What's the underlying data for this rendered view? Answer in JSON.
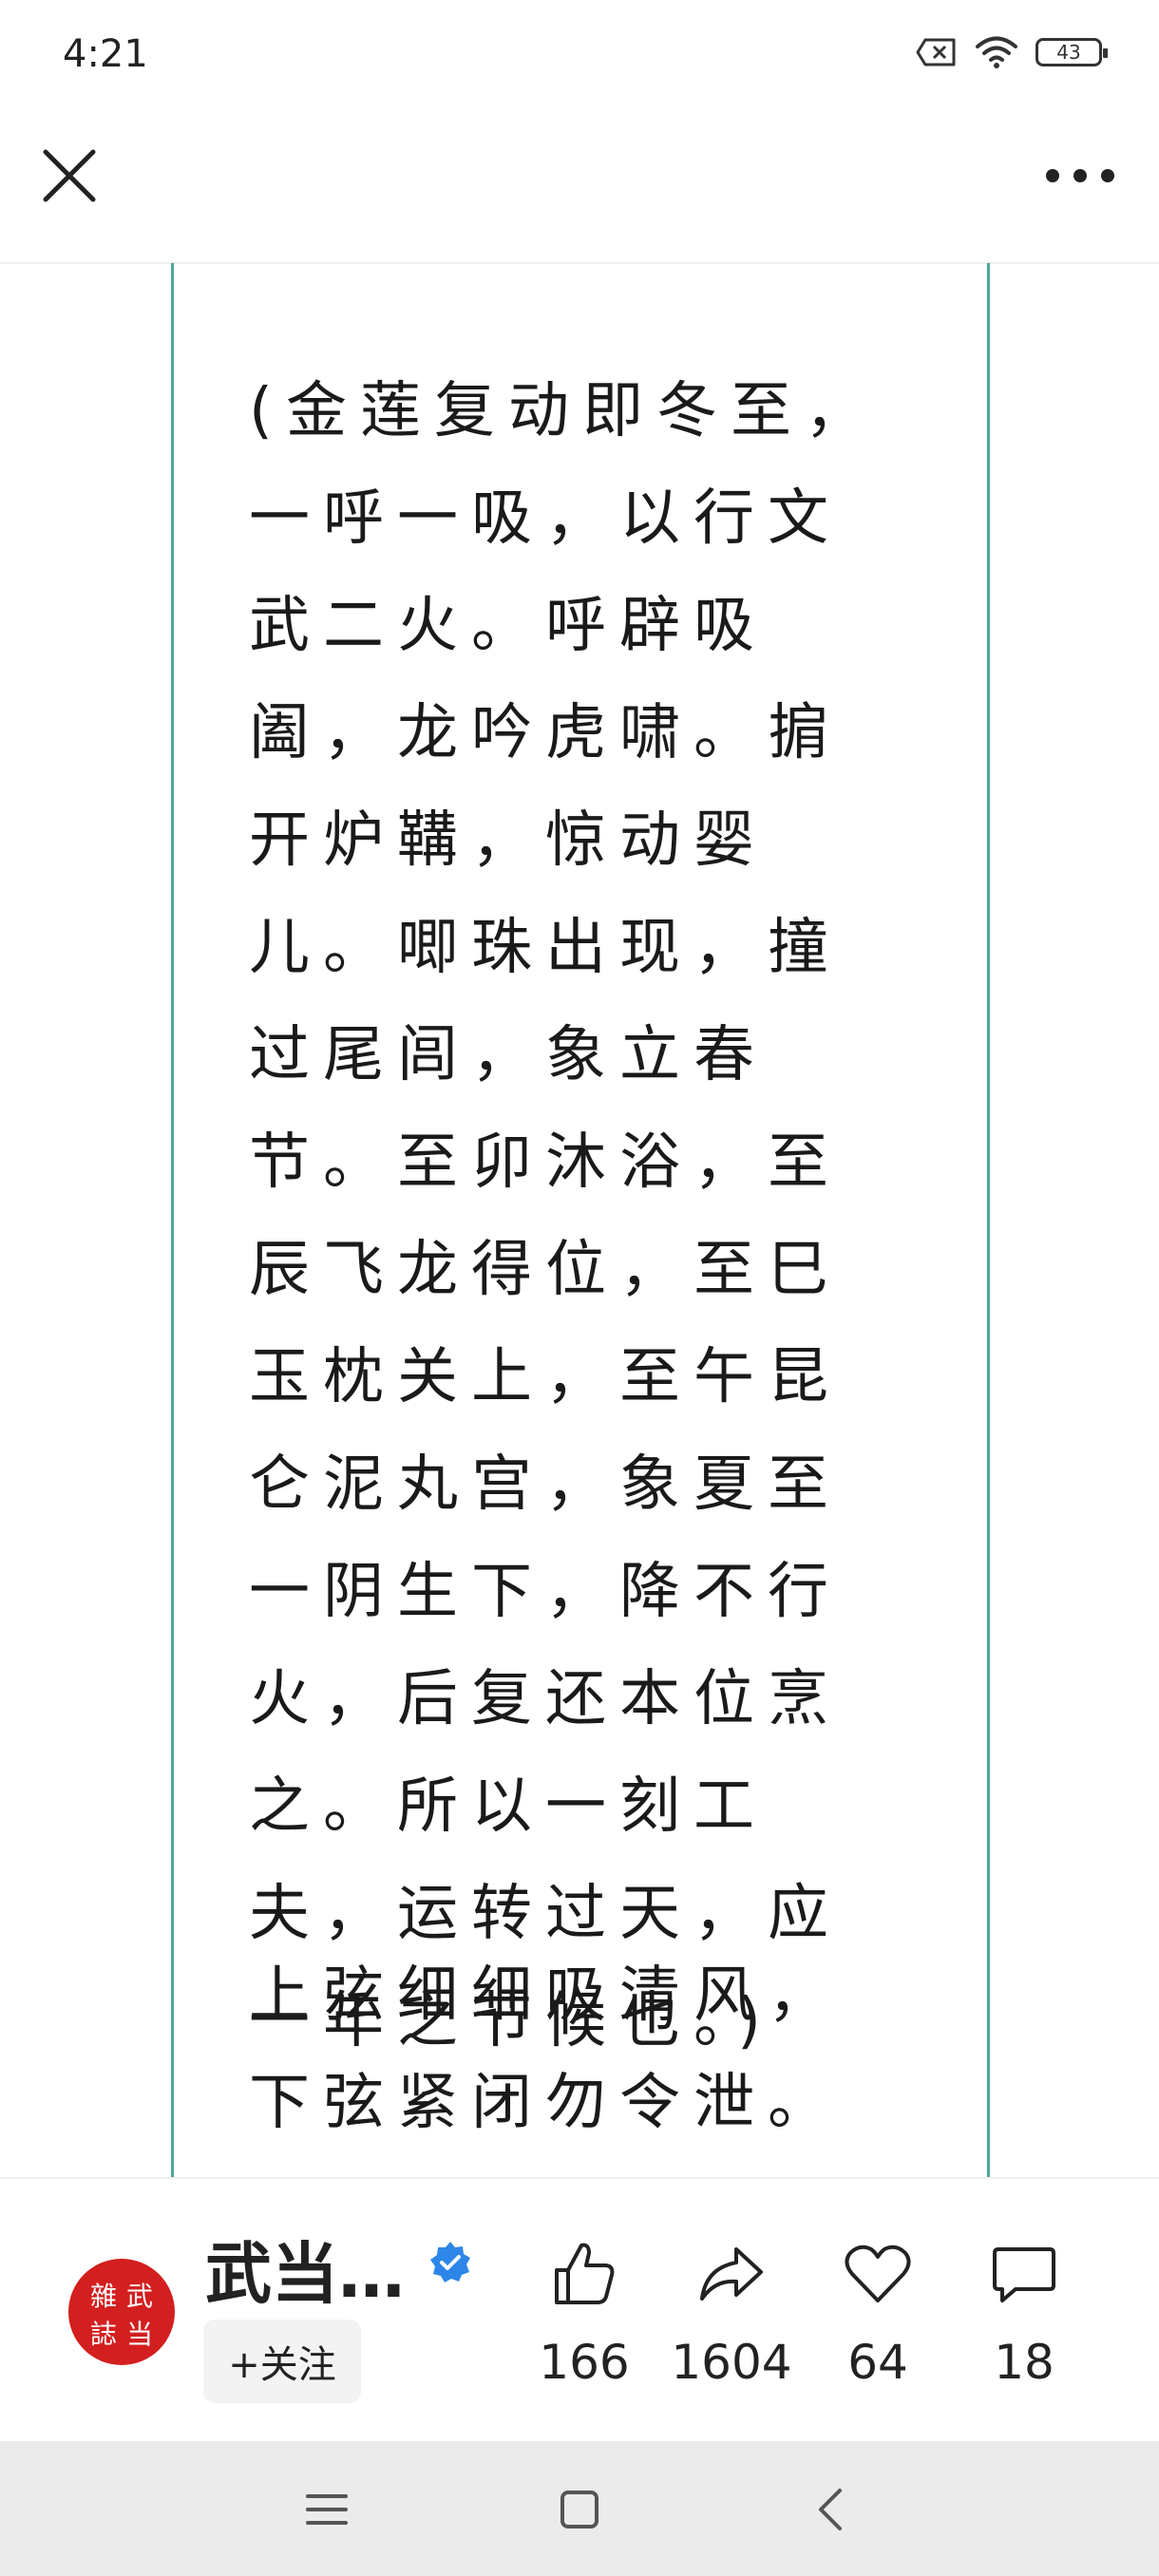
{
  "status_bar": {
    "time": "4:21",
    "battery_level": "43"
  },
  "icons": [
    "close-icon",
    "more-icon",
    "like-icon",
    "share-icon",
    "heart-icon",
    "comment-icon",
    "verified-icon"
  ],
  "article": {
    "paragraph1": "(金莲复动即冬至，一呼一吸，以行文武二火。呼辟吸阖，龙吟虎啸。掮开炉鞲，惊动婴儿。唧珠出现，撞过尾闾，象立春节。至卯沐浴，至辰飞龙得位，至巳玉枕关上，至午昆仑泥丸宫，象夏至一阴生下，降不行火，后复还本位烹之。所以一刻工夫，运转过天，应一年之节候也。)",
    "paragraph2": "上弦细细吸清风，下弦紧闭勿令泄。"
  },
  "author": {
    "name": "武当…",
    "avatar_chars": [
      "雜",
      "武",
      "誌",
      "当"
    ],
    "follow_label": "+关注"
  },
  "actions": {
    "like_count": "166",
    "share_count": "1604",
    "favorite_count": "64",
    "comment_count": "18"
  },
  "colors": {
    "frame": "#4aa79c",
    "verified": "#2d86e8",
    "avatar": "#d31f1f"
  }
}
